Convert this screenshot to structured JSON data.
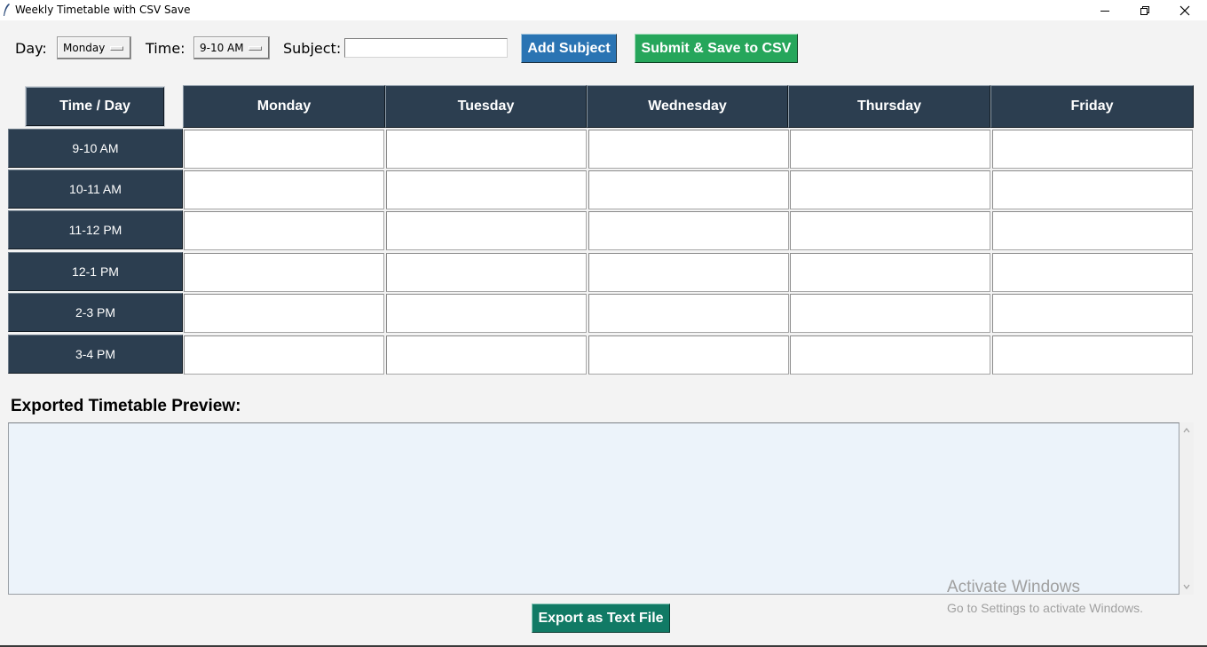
{
  "window": {
    "title": "Weekly Timetable with CSV Save"
  },
  "toolbar": {
    "day_label": "Day:",
    "day_value": "Monday",
    "time_label": "Time:",
    "time_value": "9-10 AM",
    "subject_label": "Subject:",
    "subject_value": "",
    "add_label": "Add Subject",
    "submit_label": "Submit & Save to CSV"
  },
  "grid": {
    "corner_label": "Time / Day",
    "days": [
      "Monday",
      "Tuesday",
      "Wednesday",
      "Thursday",
      "Friday"
    ],
    "times": [
      "9-10 AM",
      "10-11 AM",
      "11-12 PM",
      "12-1 PM",
      "2-3 PM",
      "3-4 PM"
    ],
    "cells": [
      [
        "",
        "",
        "",
        "",
        ""
      ],
      [
        "",
        "",
        "",
        "",
        ""
      ],
      [
        "",
        "",
        "",
        "",
        ""
      ],
      [
        "",
        "",
        "",
        "",
        ""
      ],
      [
        "",
        "",
        "",
        "",
        ""
      ],
      [
        "",
        "",
        "",
        "",
        ""
      ]
    ]
  },
  "preview": {
    "label": "Exported Timetable Preview:",
    "content": ""
  },
  "export": {
    "label": "Export as Text File"
  },
  "watermark": {
    "line1": "Activate Windows",
    "line2": "Go to Settings to activate Windows."
  },
  "colors": {
    "header_bg": "#2c3e50",
    "add_button": "#2a74b3",
    "submit_button": "#26a65b",
    "export_button": "#117a65",
    "preview_bg": "#ecf3fa"
  }
}
